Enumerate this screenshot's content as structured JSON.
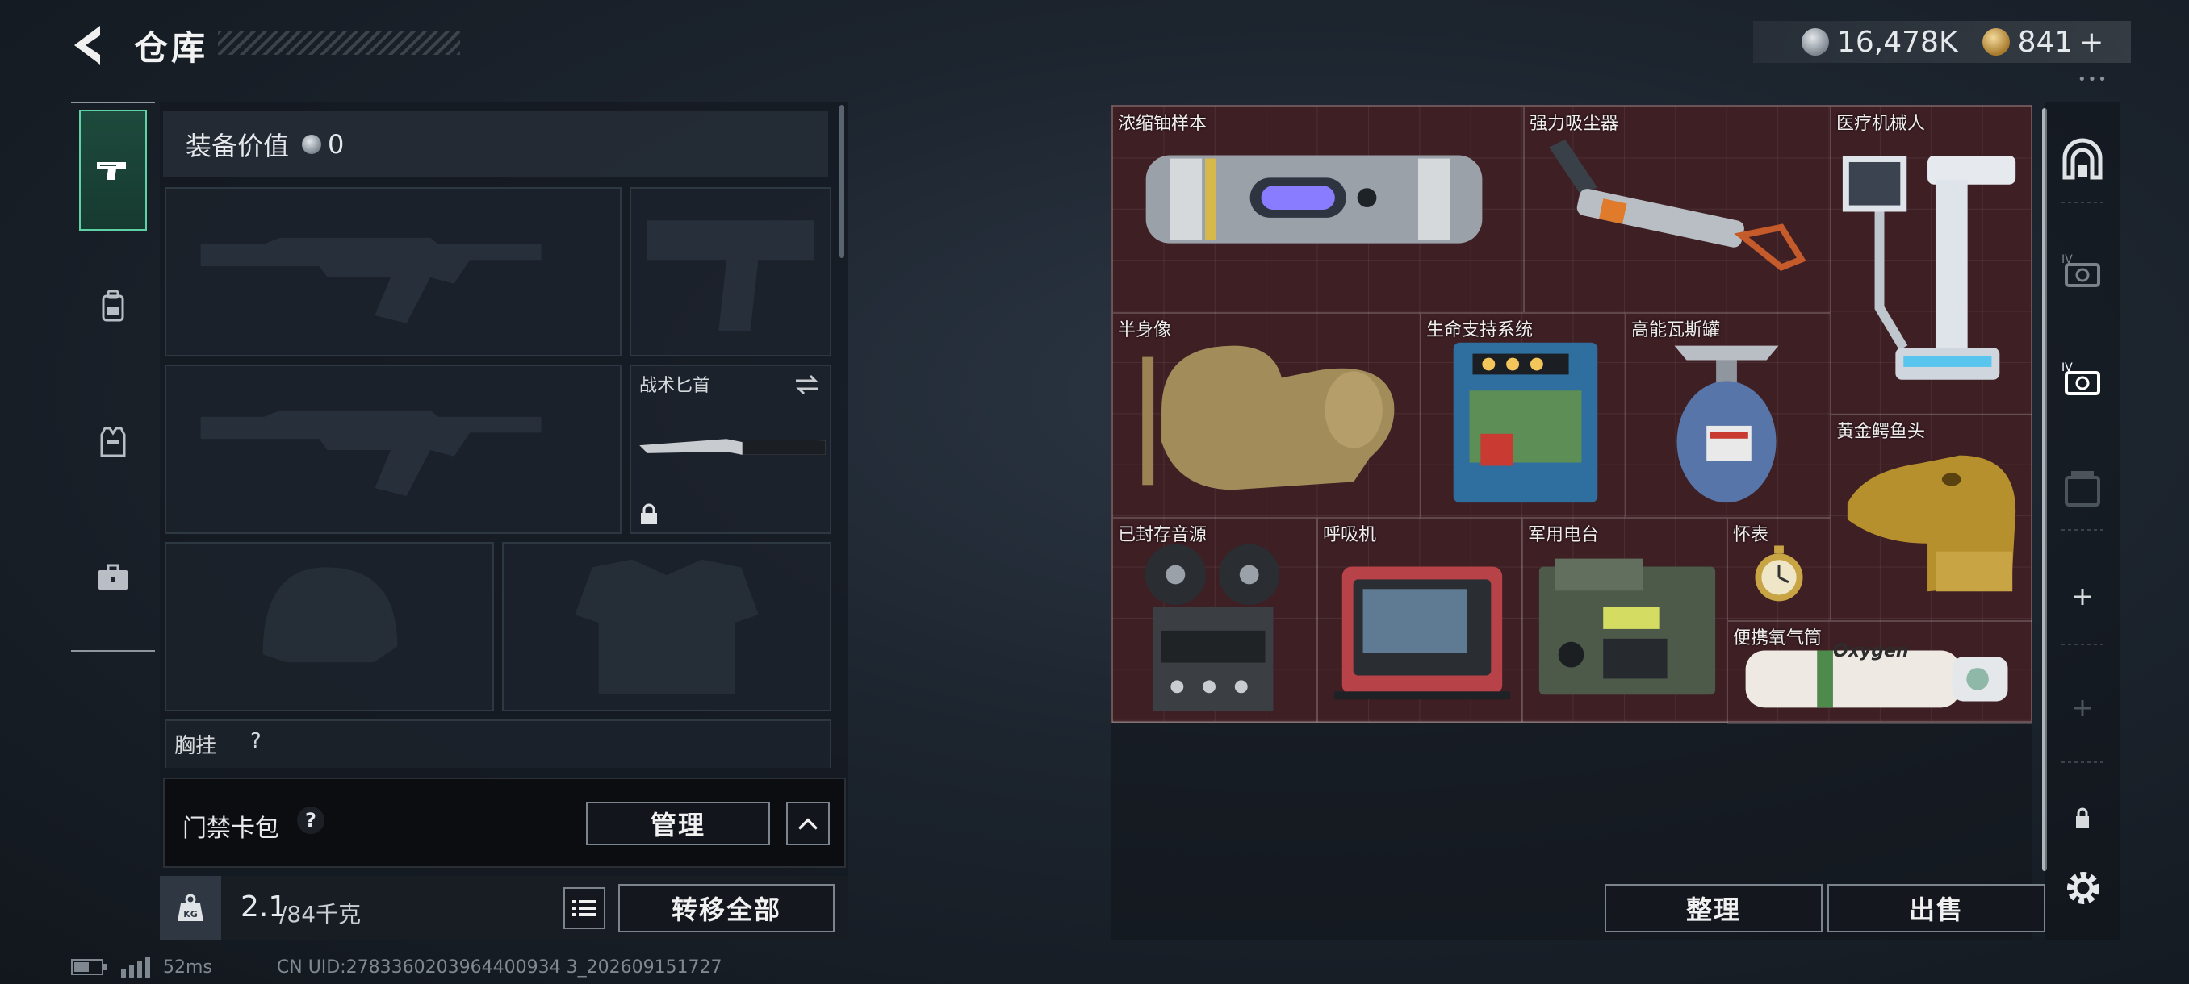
{
  "header": {
    "title": "仓库",
    "currency_silver": "16,478K",
    "currency_gold": "841",
    "gold_add": "+"
  },
  "left_tabs": [
    "pistol-icon",
    "backpack-icon",
    "vest-icon",
    "toolbox-icon"
  ],
  "equipment": {
    "value_label": "装备价值",
    "value": "0",
    "knife_label": "战术匕首",
    "chest_rig_label": "胸挂",
    "chest_rig_help": "?"
  },
  "keycard": {
    "label": "门禁卡包",
    "help": "?",
    "manage_button": "管理"
  },
  "weight": {
    "current": "2.1",
    "capacity": "/84千克",
    "transfer_all_button": "转移全部"
  },
  "storage": {
    "items": [
      {
        "name": "浓缩铀样本"
      },
      {
        "name": "强力吸尘器"
      },
      {
        "name": "医疗机械人"
      },
      {
        "name": "半身像"
      },
      {
        "name": "生命支持系统"
      },
      {
        "name": "高能瓦斯罐"
      },
      {
        "name": "黄金鳄鱼头"
      },
      {
        "name": "已封存音源"
      },
      {
        "name": "呼吸机"
      },
      {
        "name": "军用电台"
      },
      {
        "name": "怀表"
      },
      {
        "name": "便携氧气筒"
      }
    ],
    "oxygen_text": "Oxygen",
    "sort_button": "整理",
    "sell_button": "出售",
    "border_color": "#6b5256",
    "cell_color": "#3e1f24"
  },
  "right_tabs": [
    "warehouse-arch-icon",
    "level-iv-case-icon",
    "level-iv-case-active-icon",
    "locked-case-icon",
    "add-icon",
    "add-disabled-icon",
    "lock-icon"
  ],
  "status": {
    "ping": "52ms",
    "uid": "CN UID:2783360203964400934 3_202609151727"
  }
}
